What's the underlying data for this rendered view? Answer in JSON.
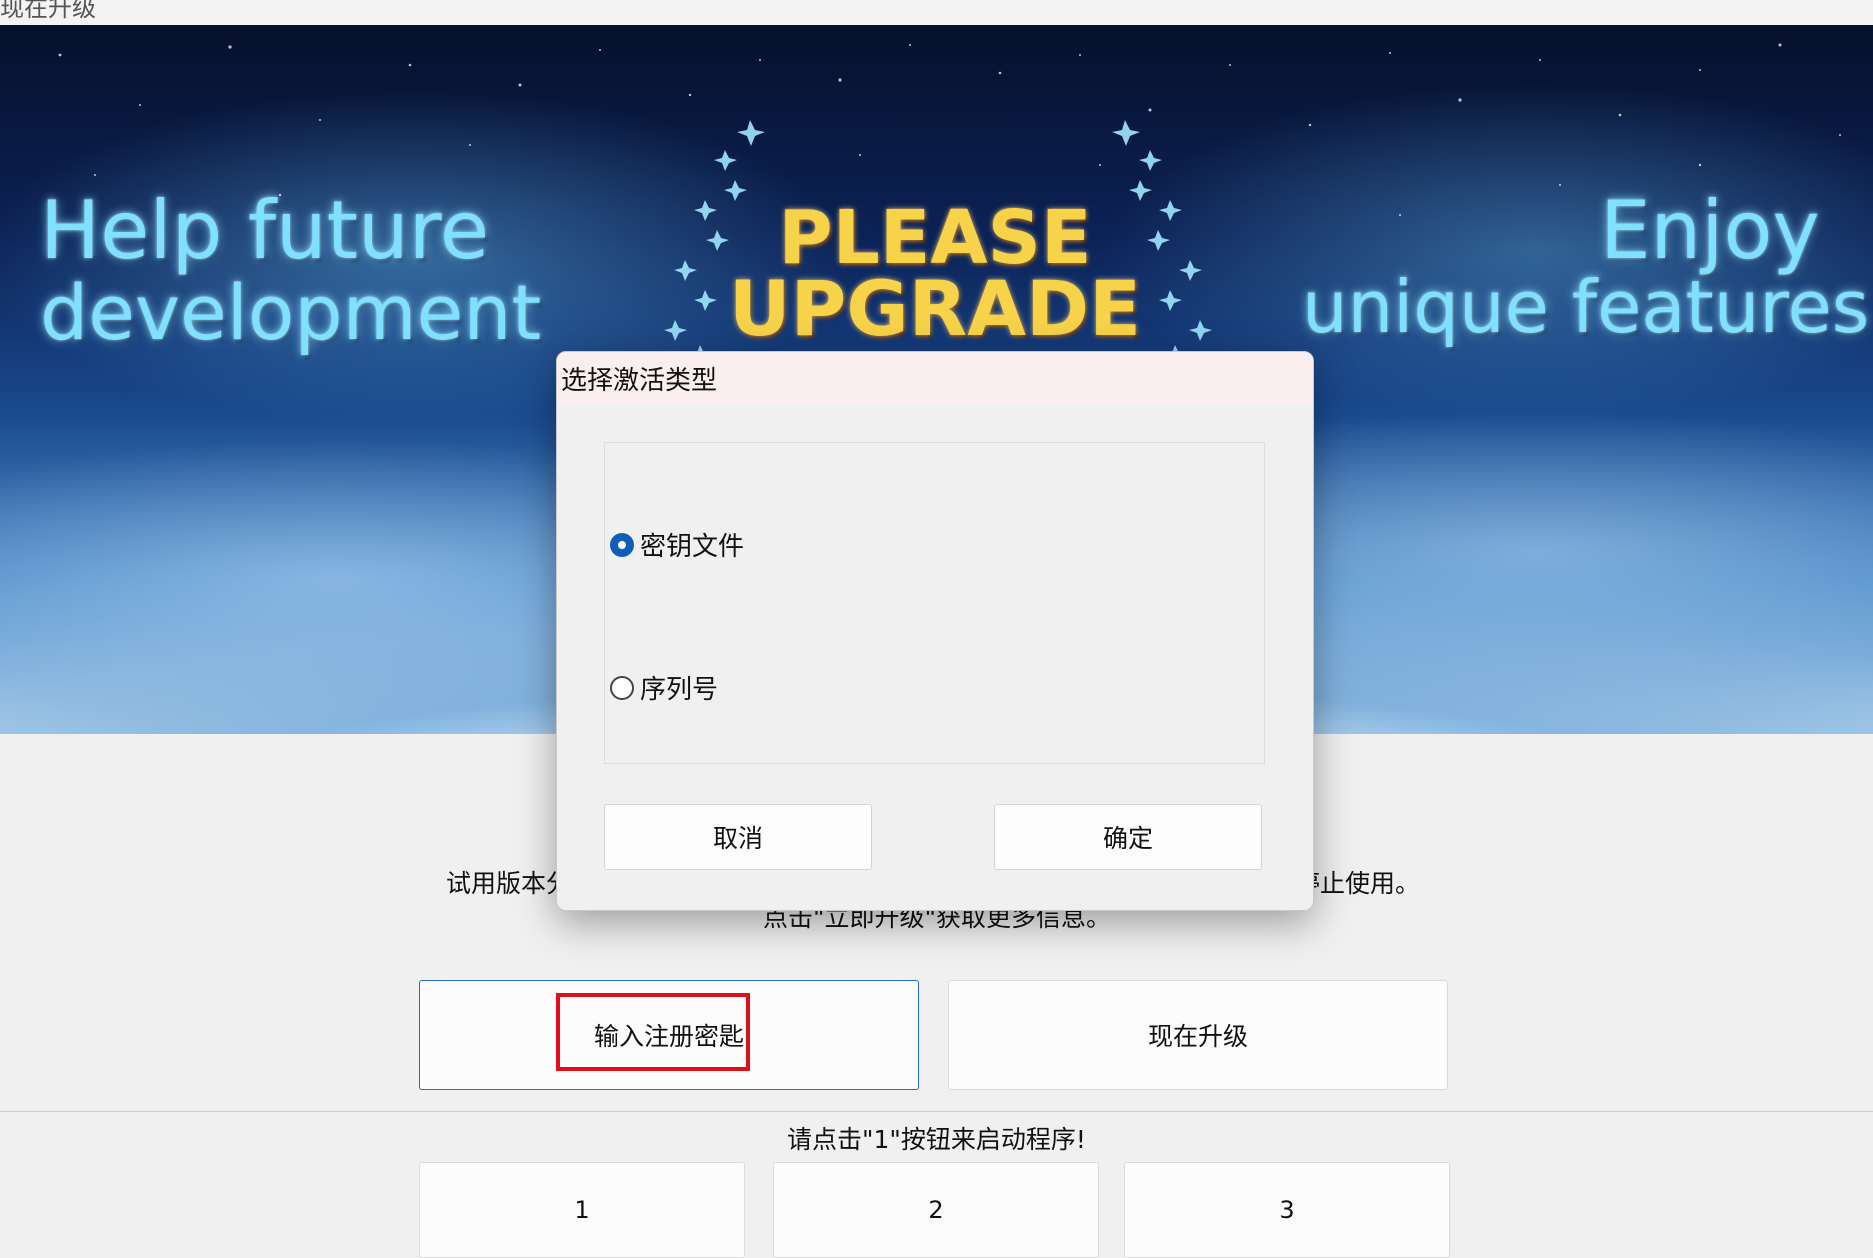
{
  "window": {
    "title": "现在升级"
  },
  "banner": {
    "left_line1": "Help future",
    "left_line2": "development",
    "headline_line1": "PLEASE",
    "headline_line2": "UPGRADE",
    "right_line1": "Enjoy",
    "right_line2": "unique features"
  },
  "main": {
    "desc_line1_left": "试用版本分",
    "desc_line1_right": "停止使用。",
    "desc_line2": "点击\"立即升级\"获取更多信息。",
    "enter_key_button": "输入注册密匙",
    "upgrade_button": "现在升级"
  },
  "footer": {
    "hint": "请点击\"1\"按钮来启动程序!",
    "buttons": [
      "1",
      "2",
      "3"
    ]
  },
  "dialog": {
    "title": "选择激活类型",
    "options": [
      {
        "label": "密钥文件",
        "checked": true
      },
      {
        "label": "序列号",
        "checked": false
      }
    ],
    "cancel": "取消",
    "ok": "确定"
  },
  "colors": {
    "accent": "#0f5fb5",
    "highlight_box": "#e0101a",
    "dialog_title_bg": "#fbeeee",
    "window_bg": "#f0f0f0"
  }
}
